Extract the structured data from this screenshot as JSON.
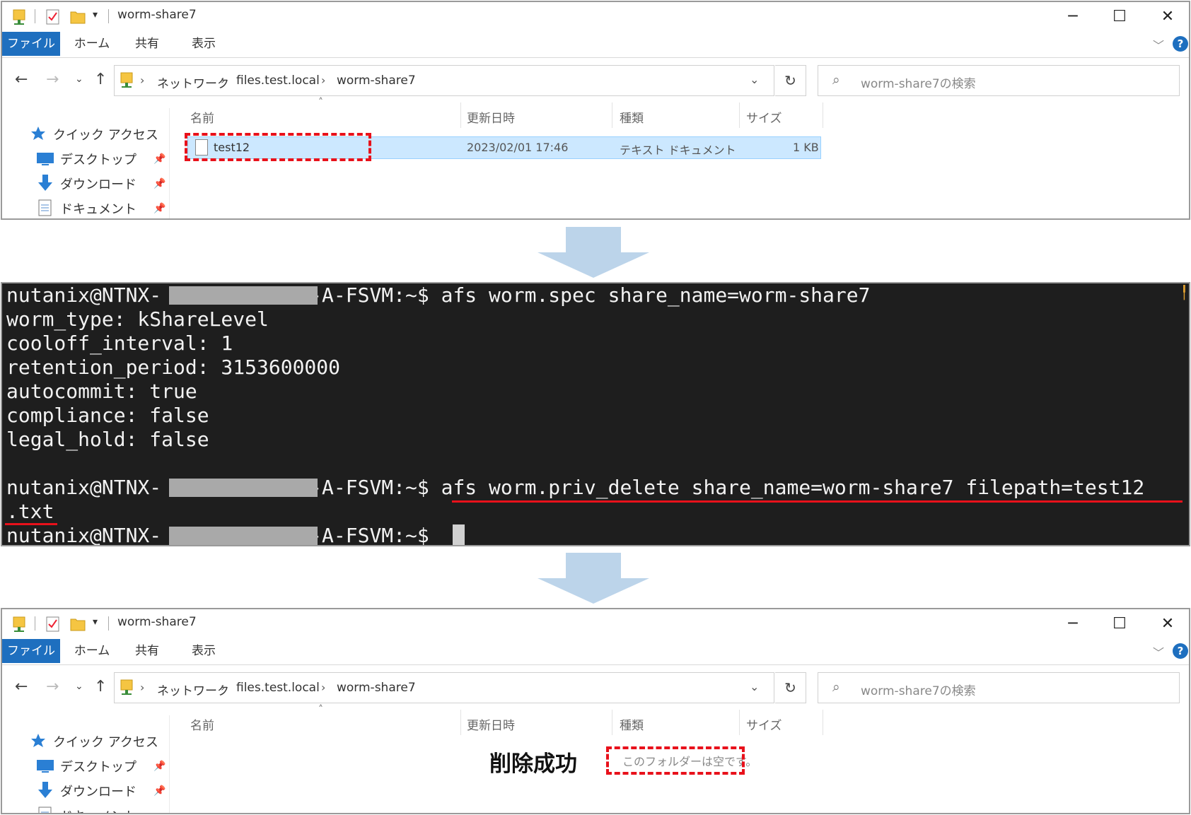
{
  "window_top": {
    "title": "worm-share7",
    "ribbon_tabs": [
      "ファイル",
      "ホーム",
      "共有",
      "表示"
    ],
    "breadcrumb": [
      "ネットワーク",
      "files.test.local",
      "worm-share7"
    ],
    "search_placeholder": "worm-share7の検索",
    "columns": [
      "名前",
      "更新日時",
      "種類",
      "サイズ"
    ],
    "sidebar": [
      "クイック アクセス",
      "デスクトップ",
      "ダウンロード",
      "ドキュメント"
    ],
    "file": {
      "name": "test12",
      "modified": "2023/02/01 17:46",
      "type": "テキスト ドキュメント",
      "size": "1 KB"
    }
  },
  "terminal": {
    "prompt_prefix": "nutanix@NTNX-",
    "prompt_suffix": "-A-FSVM:~$",
    "cmd1": " afs worm.spec share_name=worm-share7",
    "output": [
      "worm_type: kShareLevel",
      "cooloff_interval: 1",
      "retention_period: 3153600000",
      "autocommit: true",
      "compliance: false",
      "legal_hold: false"
    ],
    "cmd2": " afs worm.priv_delete share_name=worm-share7 filepath=test12",
    "cmd2_cont": ".txt"
  },
  "window_bottom": {
    "title": "worm-share7",
    "ribbon_tabs": [
      "ファイル",
      "ホーム",
      "共有",
      "表示"
    ],
    "breadcrumb": [
      "ネットワーク",
      "files.test.local",
      "worm-share7"
    ],
    "search_placeholder": "worm-share7の検索",
    "columns": [
      "名前",
      "更新日時",
      "種類",
      "サイズ"
    ],
    "sidebar": [
      "クイック アクセス",
      "デスクトップ",
      "ダウンロード",
      "ドキュメント"
    ],
    "success_label": "削除成功",
    "empty_message": "このフォルダーは空です。"
  },
  "colors": {
    "accent": "#1e6fbf",
    "highlight_red": "#e8111b",
    "arrow": "#bcd4ea",
    "selection": "#cce8ff",
    "terminal_bg": "#1e1e1e"
  },
  "icons": [
    "folder-icon",
    "checklist-icon",
    "pin-icon",
    "star-icon",
    "desktop-icon",
    "download-icon",
    "document-icon",
    "refresh-icon",
    "search-icon",
    "help-icon"
  ]
}
